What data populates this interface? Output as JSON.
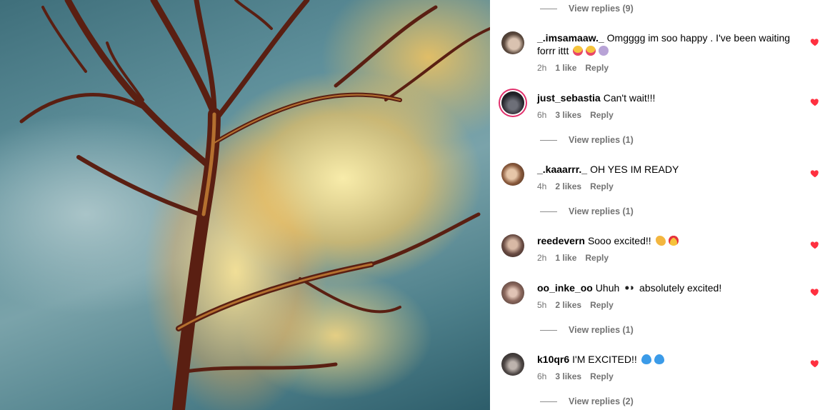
{
  "top_replies": {
    "label": "View replies (9)"
  },
  "comments": [
    {
      "username": "_.imsamaaw._",
      "text": "Omgggg im soo happy . I've been waiting forrr ittt",
      "emojis": [
        "crying-face-emoji",
        "crying-face-emoji",
        "shell-emoji"
      ],
      "time": "2h",
      "likes": "1 like",
      "reply": "Reply",
      "replies": null
    },
    {
      "username": "just_sebastia",
      "text": "Can't wait!!!",
      "emojis": [],
      "time": "6h",
      "likes": "3 likes",
      "reply": "Reply",
      "replies": "View replies (1)"
    },
    {
      "username": "_.kaaarrr._",
      "text": "OH YES IM READY",
      "emojis": [],
      "time": "4h",
      "likes": "2 likes",
      "reply": "Reply",
      "replies": "View replies (1)"
    },
    {
      "username": "reedevern",
      "text": "Sooo excited!!",
      "emojis": [
        "clapping-hands-emoji",
        "heart-eyes-emoji"
      ],
      "time": "2h",
      "likes": "1 like",
      "reply": "Reply",
      "replies": null
    },
    {
      "username": "oo_inke_oo",
      "text_before": "Uhuh",
      "text_after": "absolutely excited!",
      "emojis": [
        "eyes-emoji"
      ],
      "time": "5h",
      "likes": "2 likes",
      "reply": "Reply",
      "replies": "View replies (1)"
    },
    {
      "username": "k10qr6",
      "text": "I'M EXCITED!!",
      "emojis": [
        "blue-heart-emoji",
        "blue-heart-emoji"
      ],
      "time": "6h",
      "likes": "3 likes",
      "reply": "Reply",
      "replies": "View replies (2)"
    }
  ],
  "colors": {
    "heart": "#ff3040",
    "meta": "#737373",
    "story_ring": "#e1306c"
  }
}
